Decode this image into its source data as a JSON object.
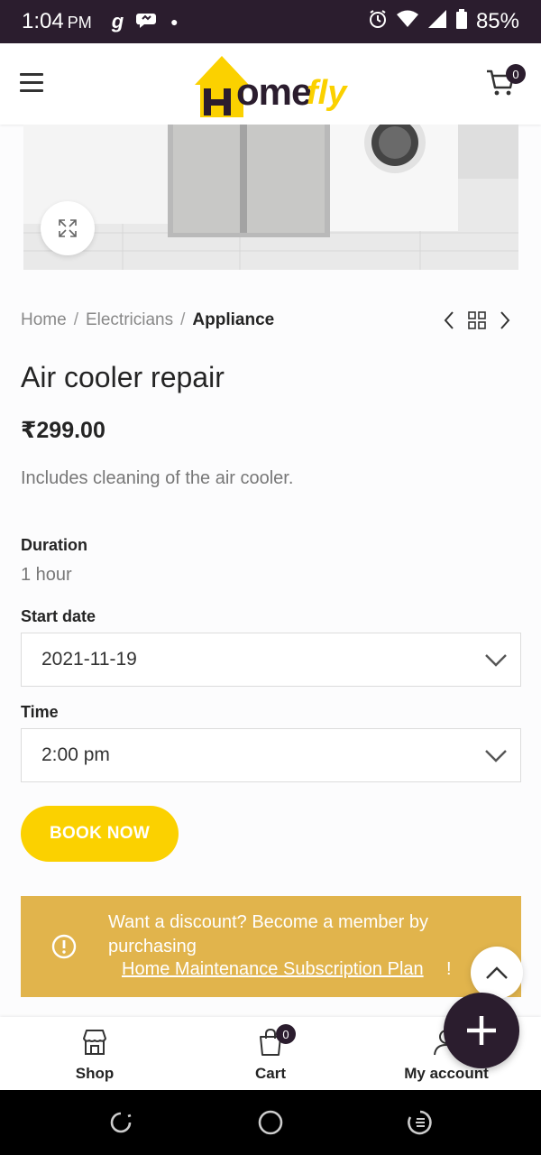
{
  "status_bar": {
    "time": "1:04",
    "ampm": "PM",
    "battery": "85%",
    "left_icons": [
      "g-icon",
      "message-icon",
      "dot-icon"
    ],
    "right_icons": [
      "alarm-icon",
      "wifi-icon",
      "signal-icon",
      "battery-icon"
    ]
  },
  "header": {
    "logo_text_home": "ome",
    "logo_text_fly": "fly",
    "logo_letter": "H",
    "cart_count": "0"
  },
  "breadcrumb": {
    "items": [
      "Home",
      "Electricians",
      "Appliance"
    ],
    "separator": "/"
  },
  "product": {
    "title": "Air cooler repair",
    "price": "₹299.00",
    "short_description": "Includes cleaning of the air cooler."
  },
  "booking": {
    "duration_label": "Duration",
    "duration_value": "1 hour",
    "start_date_label": "Start date",
    "start_date_value": "2021-11-19",
    "time_label": "Time",
    "time_value": "2:00 pm",
    "book_button": "BOOK NOW"
  },
  "notice": {
    "text": "Want a discount? Become a member by purchasing",
    "link": "Home Maintenance Subscription Plan",
    "suffix": "!"
  },
  "bottom_nav": {
    "shop": "Shop",
    "cart": "Cart",
    "cart_count": "0",
    "account": "My account"
  },
  "colors": {
    "brand_yellow": "#fbd100",
    "brand_dark": "#2b1d2e",
    "notice_bg": "#e1b44c"
  }
}
